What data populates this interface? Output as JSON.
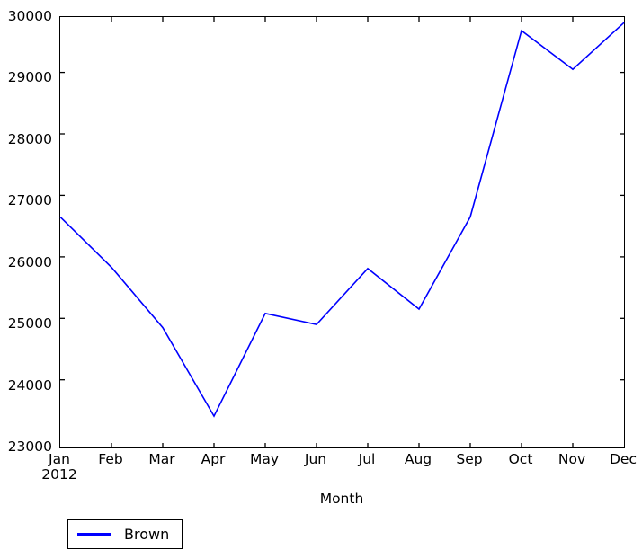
{
  "chart_data": {
    "type": "line",
    "title": "",
    "xlabel": "Month",
    "ylabel": "",
    "categories": [
      "Jan",
      "Feb",
      "Mar",
      "Apr",
      "May",
      "Jun",
      "Jul",
      "Aug",
      "Sep",
      "Oct",
      "Nov",
      "Dec"
    ],
    "x_sublabel": "2012",
    "series": [
      {
        "name": "Brown",
        "color": "#0000ff",
        "values": [
          26750,
          25930,
          24950,
          23510,
          25180,
          25000,
          25910,
          25250,
          26750,
          29780,
          29150,
          29910
        ]
      }
    ],
    "ylim": [
      23000,
      30000
    ],
    "y_ticks": [
      30000,
      29000,
      28000,
      27000,
      26000,
      25000,
      24000,
      23000
    ],
    "y_tick_labels": [
      "30000",
      "29000",
      "28000",
      "27000",
      "26000",
      "25000",
      "24000",
      "23000"
    ],
    "grid": false,
    "legend_position": "below-left"
  },
  "legend": {
    "entries": [
      {
        "label": "Brown",
        "color": "#0000ff"
      }
    ]
  },
  "axes": {
    "x_title": "Month",
    "x_tick_labels": [
      "Jan",
      "Feb",
      "Mar",
      "Apr",
      "May",
      "Jun",
      "Jul",
      "Aug",
      "Sep",
      "Oct",
      "Nov",
      "Dec"
    ],
    "x_year_label": "2012",
    "y_tick_labels": [
      "30000",
      "29000",
      "28000",
      "27000",
      "26000",
      "25000",
      "24000",
      "23000"
    ]
  },
  "colors": {
    "line": "#0000ff",
    "axis": "#000000",
    "background": "#ffffff"
  }
}
